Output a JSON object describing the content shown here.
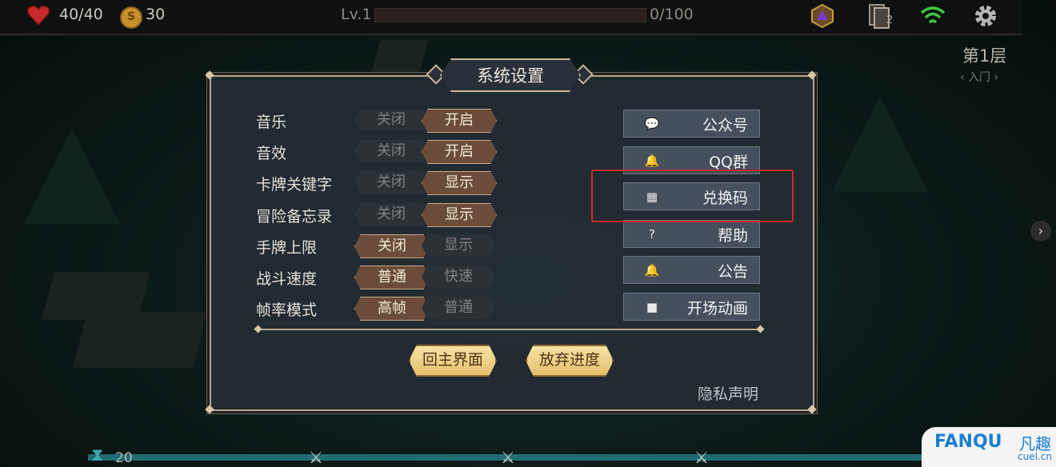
{
  "topbar": {
    "hp": "40/40",
    "gold": "30",
    "coin_glyph": "S",
    "level": "Lv.1",
    "xp": "0/100",
    "xp_progress": 0,
    "deck_count": "2",
    "icons": [
      "heart-icon",
      "coin-icon",
      "d20-dice-icon",
      "deck-cards-icon",
      "wifi-icon",
      "gear-icon"
    ]
  },
  "floor": {
    "title": "第1层",
    "subtitle": "入门"
  },
  "dialog": {
    "title": "系统设置",
    "settings": [
      {
        "label": "音乐",
        "options": [
          "关闭",
          "开启"
        ],
        "selected": 1
      },
      {
        "label": "音效",
        "options": [
          "关闭",
          "开启"
        ],
        "selected": 1
      },
      {
        "label": "卡牌关键字",
        "options": [
          "关闭",
          "显示"
        ],
        "selected": 1
      },
      {
        "label": "冒险备忘录",
        "options": [
          "关闭",
          "显示"
        ],
        "selected": 1
      },
      {
        "label": "手牌上限",
        "options": [
          "关闭",
          "显示"
        ],
        "selected": 0
      },
      {
        "label": "战斗速度",
        "options": [
          "普通",
          "快速"
        ],
        "selected": 0
      },
      {
        "label": "帧率模式",
        "options": [
          "高帧",
          "普通"
        ],
        "selected": 0
      }
    ],
    "links": [
      {
        "label": "公众号",
        "icon": "wechat-icon",
        "glyph": "💬"
      },
      {
        "label": "QQ群",
        "icon": "qq-icon",
        "glyph": "🔔"
      },
      {
        "label": "兑换码",
        "icon": "qr-code-icon",
        "glyph": "▦"
      },
      {
        "label": "帮助",
        "icon": "help-icon",
        "glyph": "?"
      },
      {
        "label": "公告",
        "icon": "bell-icon",
        "glyph": "🔔"
      },
      {
        "label": "开场动画",
        "icon": "video-camera-icon",
        "glyph": "■"
      }
    ],
    "main_menu_button": "回主界面",
    "abandon_button": "放弃进度",
    "privacy": "隐私声明"
  },
  "bottom": {
    "turn_count": "20"
  },
  "watermark": {
    "brand": "FANQU",
    "cn": "凡趣",
    "domain": "cuel.cn"
  },
  "colors": {
    "highlight": "#d4282a",
    "selected": "#6b4c3a",
    "gold_button": "#e4c06d"
  }
}
